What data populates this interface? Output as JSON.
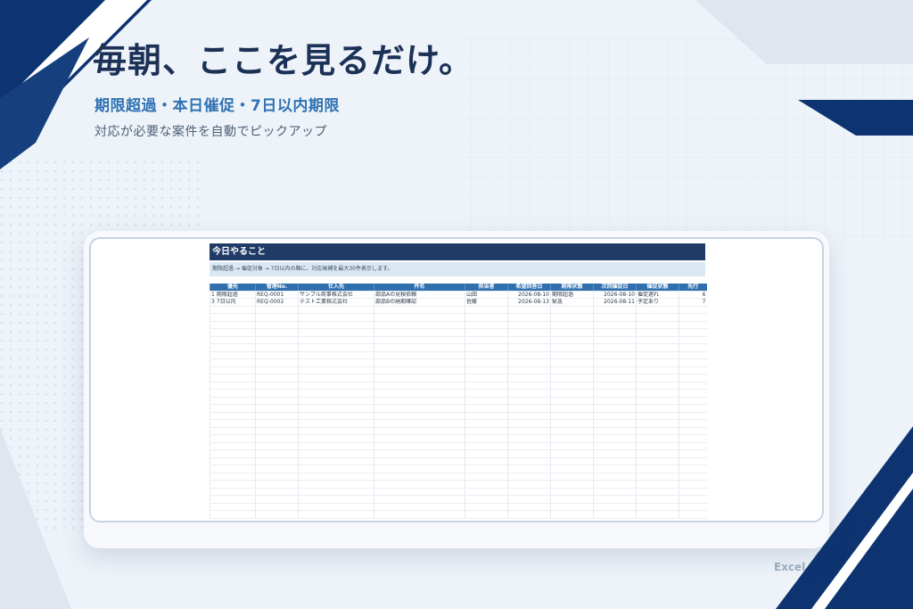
{
  "headline": "毎朝、ここを見るだけ。",
  "subheadline": "期限超過・本日催促・7日以内期限",
  "description": "対応が必要な案件を自動でピックアップ",
  "footer_label": "Excel",
  "colors": {
    "navy": "#1f3b66",
    "header_blue": "#2f6fae",
    "accent_blue": "#2f72b3",
    "note_bg": "#dae8f4"
  },
  "sheet": {
    "title": "今日やること",
    "note": "期限超過 → 催促対象 → 7日以内の順に、対応候補を最大30件表示します。",
    "columns": [
      "優先",
      "管理No.",
      "仕入先",
      "件名",
      "担当者",
      "希望回答日",
      "期限状態",
      "次回催促日",
      "催促状態",
      "先行"
    ],
    "rows": [
      {
        "priority": "1",
        "priority_label": "期限超過",
        "id": "REQ-0001",
        "supplier": "サンプル商事株式会社",
        "subject": "部品Aの見積依頼",
        "owner": "山田",
        "reply_date": "2026-08-10",
        "due_status": "期限超過",
        "next_date": "2026-08-10",
        "remind_status": "催促遅れ",
        "lead": "6"
      },
      {
        "priority": "3",
        "priority_label": "7日以内",
        "id": "REQ-0002",
        "supplier": "テスト工業株式会社",
        "subject": "部品Bの納期確認",
        "owner": "佐藤",
        "reply_date": "2026-08-13",
        "due_status": "緊急",
        "next_date": "2026-08-11",
        "remind_status": "予定あり",
        "lead": "7"
      }
    ]
  }
}
